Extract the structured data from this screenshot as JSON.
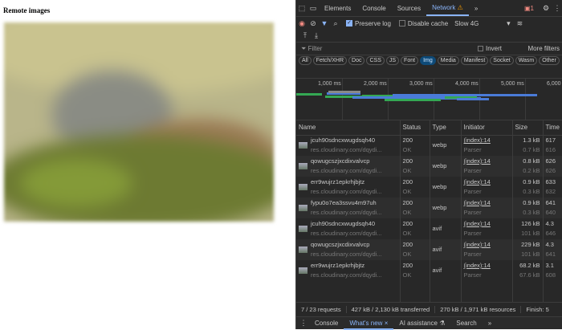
{
  "page": {
    "heading": "Remote images"
  },
  "devtools": {
    "tabs": [
      "Elements",
      "Console",
      "Sources",
      "Network",
      "»"
    ],
    "active_tab": "Network",
    "error_count": "1",
    "toolbar": {
      "preserve_log": "Preserve log",
      "preserve_log_checked": true,
      "disable_cache": "Disable cache",
      "disable_cache_checked": false,
      "throttle": "Slow 4G"
    },
    "filter": {
      "placeholder": "Filter",
      "invert": "Invert",
      "more_filters": "More filters"
    },
    "chips": [
      "All",
      "Fetch/XHR",
      "Doc",
      "CSS",
      "JS",
      "Font",
      "Img",
      "Media",
      "Manifest",
      "Socket",
      "Wasm",
      "Other"
    ],
    "selected_chip": "Img",
    "timeline_ticks": [
      "1,000 ms",
      "2,000 ms",
      "3,000 ms",
      "4,000 ms",
      "5,000 ms",
      "6,000"
    ],
    "columns": [
      "Name",
      "Status",
      "Type",
      "Initiator",
      "Size",
      "Time"
    ],
    "rows": [
      {
        "name": "jcuh90sdncxwugdsqh40",
        "url": "res.cloudinary.com/dqydi...",
        "status": "200",
        "status_text": "OK",
        "type": "webp",
        "initiator": "(index):14",
        "initiator_sub": "Parser",
        "size": "1.3 kB",
        "size_sub": "0.7 kB",
        "time": "617",
        "time_sub": "616"
      },
      {
        "name": "qowugcszjxcdixvalvcp",
        "url": "res.cloudinary.com/dqydi...",
        "status": "200",
        "status_text": "OK",
        "type": "webp",
        "initiator": "(index):14",
        "initiator_sub": "Parser",
        "size": "0.8 kB",
        "size_sub": "0.2 kB",
        "time": "626",
        "time_sub": "626"
      },
      {
        "name": "err9wujrz1epkrhjbjtz",
        "url": "res.cloudinary.com/dqydi...",
        "status": "200",
        "status_text": "OK",
        "type": "webp",
        "initiator": "(index):14",
        "initiator_sub": "Parser",
        "size": "0.9 kB",
        "size_sub": "0.3 kB",
        "time": "633",
        "time_sub": "632"
      },
      {
        "name": "fypu0o7ea3ssvu4m97uh",
        "url": "res.cloudinary.com/dqydi...",
        "status": "200",
        "status_text": "OK",
        "type": "webp",
        "initiator": "(index):14",
        "initiator_sub": "Parser",
        "size": "0.9 kB",
        "size_sub": "0.3 kB",
        "time": "641",
        "time_sub": "640"
      },
      {
        "name": "jcuh90sdncxwugdsqh40",
        "url": "res.cloudinary.com/dqydi...",
        "status": "200",
        "status_text": "OK",
        "type": "avif",
        "initiator": "(index):14",
        "initiator_sub": "Parser",
        "size": "126 kB",
        "size_sub": "101 kB",
        "time": "4.3",
        "time_sub": "646"
      },
      {
        "name": "qowugcszjxcdixvalvcp",
        "url": "res.cloudinary.com/dqydi...",
        "status": "200",
        "status_text": "OK",
        "type": "avif",
        "initiator": "(index):14",
        "initiator_sub": "Parser",
        "size": "229 kB",
        "size_sub": "101 kB",
        "time": "4.3",
        "time_sub": "641"
      },
      {
        "name": "err9wujrz1epkrhjbjtz",
        "url": "res.cloudinary.com/dqydi...",
        "status": "200",
        "status_text": "OK",
        "type": "avif",
        "initiator": "(index):14",
        "initiator_sub": "Parser",
        "size": "68.2 kB",
        "size_sub": "67.6 kB",
        "time": "3.1",
        "time_sub": "608"
      }
    ],
    "status_bar": {
      "requests": "7 / 23 requests",
      "transferred": "427 kB / 2,130 kB transferred",
      "resources": "270 kB / 1,971 kB resources",
      "finish": "Finish: 5"
    },
    "drawer": {
      "tabs": [
        "Console",
        "What's new",
        "AI assistance",
        "Search",
        "»"
      ],
      "active": "What's new"
    },
    "colors": {
      "accent": "#8ab4f8",
      "selected_chip": "#0e4a78",
      "bar_green": "#34a853",
      "bar_blue": "#4a7bd8"
    }
  }
}
